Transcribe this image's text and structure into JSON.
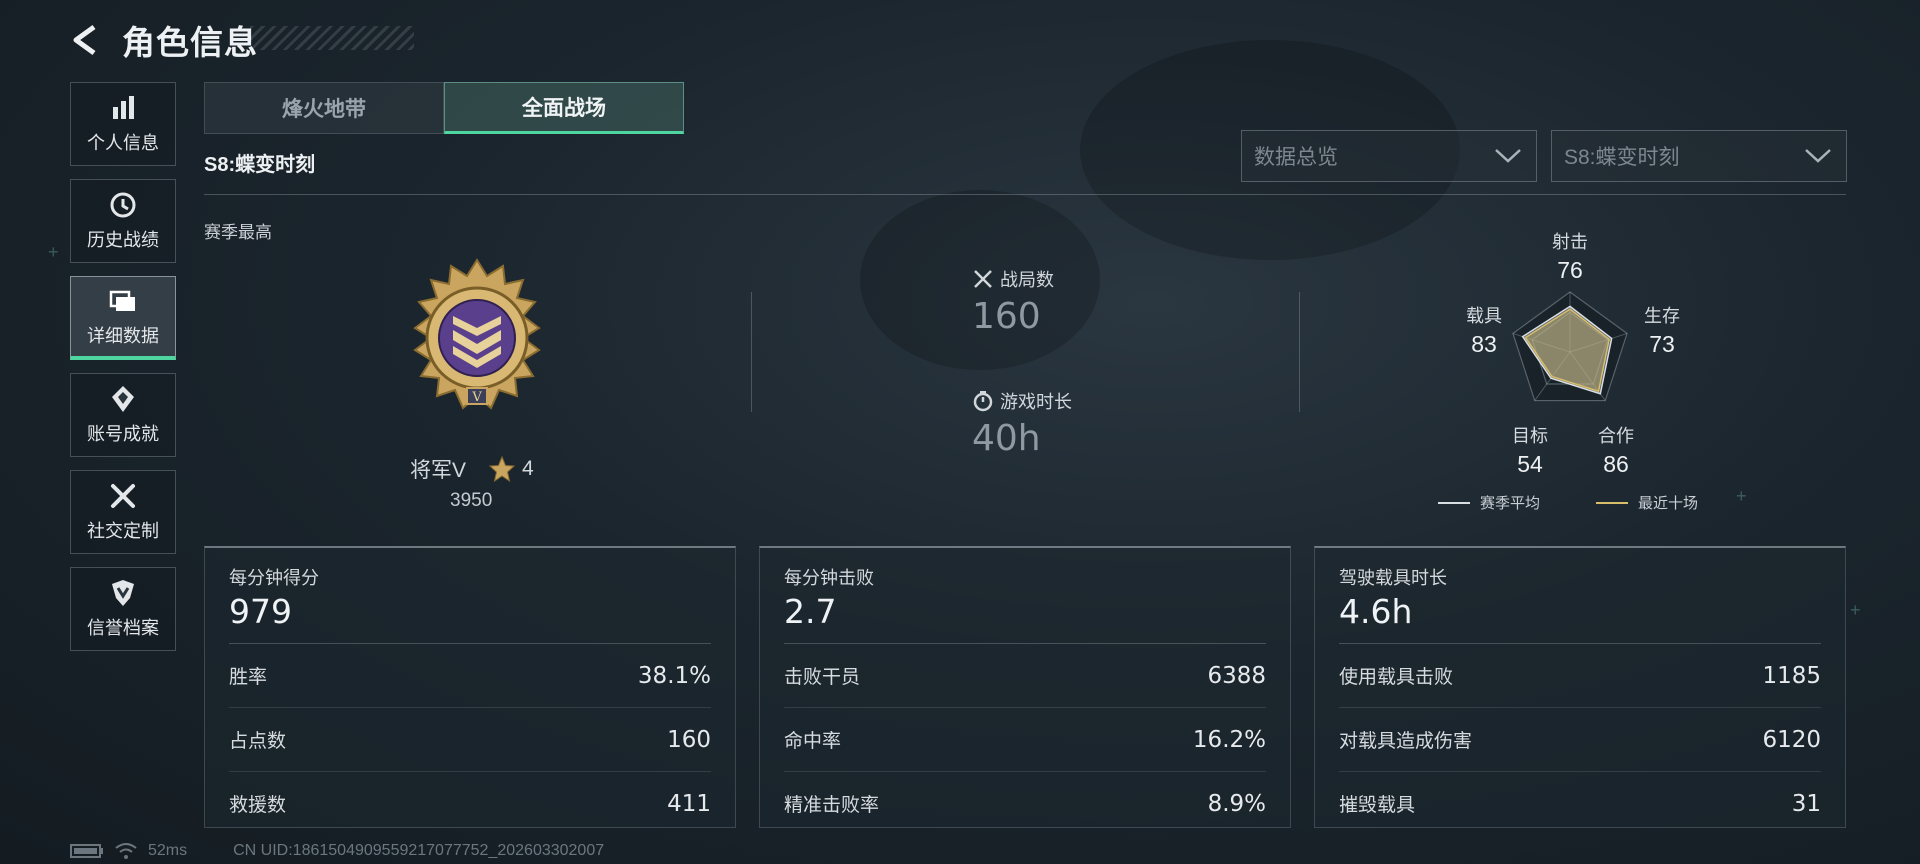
{
  "header": {
    "title": "角色信息"
  },
  "sidebar": {
    "items": [
      {
        "label": "个人信息",
        "icon": "bar-chart-icon"
      },
      {
        "label": "历史战绩",
        "icon": "history-icon"
      },
      {
        "label": "详细数据",
        "icon": "folder-icon",
        "active": true
      },
      {
        "label": "账号成就",
        "icon": "achievement-icon"
      },
      {
        "label": "社交定制",
        "icon": "tools-icon"
      },
      {
        "label": "信誉档案",
        "icon": "credit-shield-icon"
      }
    ]
  },
  "tabs": [
    {
      "label": "烽火地带"
    },
    {
      "label": "全面战场",
      "active": true
    }
  ],
  "season": {
    "title": "S8:蝶变时刻",
    "best_label": "赛季最高"
  },
  "filters": {
    "overview": "数据总览",
    "season": "S8:蝶变时刻"
  },
  "rank": {
    "name": "将军V",
    "stars": "4",
    "score": "3950"
  },
  "summary": {
    "matches_label": "战局数",
    "matches_value": "160",
    "playtime_label": "游戏时长",
    "playtime_value": "40h"
  },
  "radar": {
    "axes": [
      {
        "label": "射击",
        "value": "76"
      },
      {
        "label": "生存",
        "value": "73"
      },
      {
        "label": "合作",
        "value": "86"
      },
      {
        "label": "目标",
        "value": "54"
      },
      {
        "label": "载具",
        "value": "83"
      }
    ],
    "legend": {
      "season_avg": "赛季平均",
      "recent_ten": "最近十场"
    },
    "colors": {
      "season_avg": "#d9dee2",
      "recent_ten": "#d8bd6a"
    }
  },
  "cards": [
    {
      "title": "每分钟得分",
      "value": "979",
      "rows": [
        {
          "label": "胜率",
          "value": "38.1%"
        },
        {
          "label": "占点数",
          "value": "160"
        },
        {
          "label": "救援数",
          "value": "411"
        }
      ]
    },
    {
      "title": "每分钟击败",
      "value": "2.7",
      "rows": [
        {
          "label": "击败干员",
          "value": "6388"
        },
        {
          "label": "命中率",
          "value": "16.2%"
        },
        {
          "label": "精准击败率",
          "value": "8.9%"
        }
      ]
    },
    {
      "title": "驾驶载具时长",
      "value": "4.6h",
      "rows": [
        {
          "label": "使用载具击败",
          "value": "1185"
        },
        {
          "label": "对载具造成伤害",
          "value": "6120"
        },
        {
          "label": "摧毁载具",
          "value": "31"
        }
      ]
    }
  ],
  "footer": {
    "ping": "52ms",
    "uid": "CN UID:1861504909559217077752_202603302007"
  },
  "colors": {
    "accent": "#4fd6a0",
    "background": "#1b252d"
  }
}
